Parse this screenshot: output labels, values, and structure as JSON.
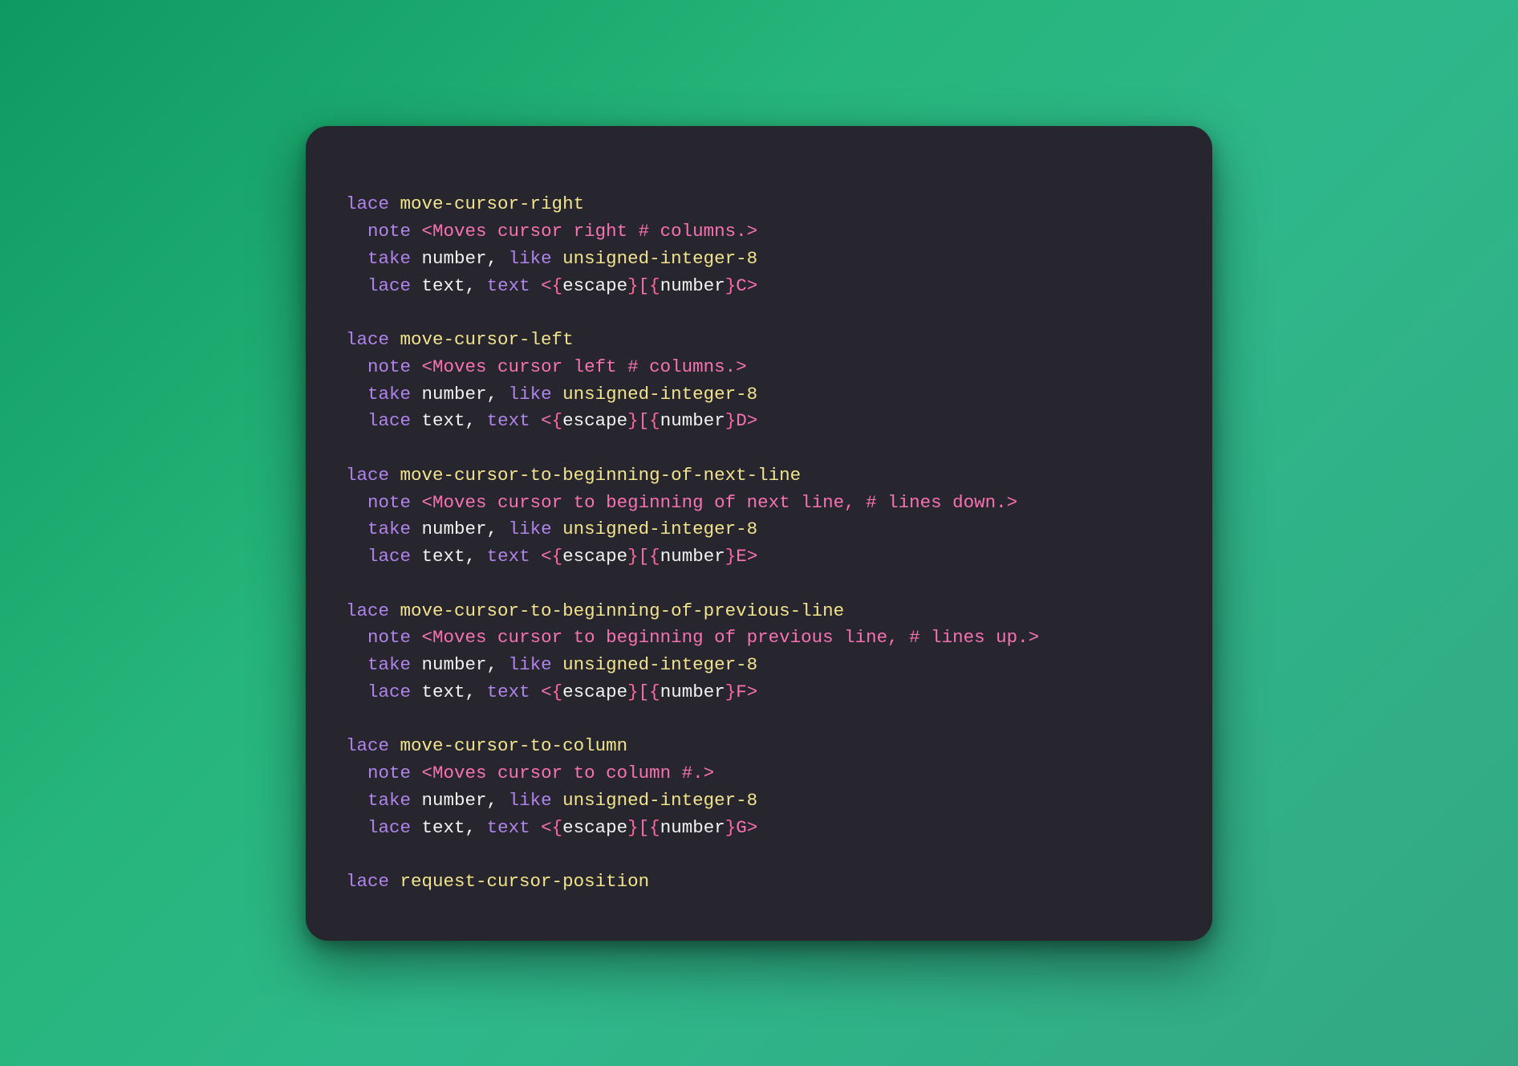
{
  "kw": {
    "lace": "lace",
    "note": "note",
    "take": "take",
    "like": "like",
    "text_kw": "text"
  },
  "tokens": {
    "number": "number",
    "text": "text",
    "uint8": "unsigned-integer-8",
    "escape": "escape",
    "lbr": "{",
    "rbr": "}",
    "lt": "<",
    "gt": ">",
    "lbracket": "[",
    "comma_sp": ", "
  },
  "blocks": [
    {
      "name": "move-cursor-right",
      "note": "Moves cursor right # columns.",
      "suffix": "C"
    },
    {
      "name": "move-cursor-left",
      "note": "Moves cursor left # columns.",
      "suffix": "D"
    },
    {
      "name": "move-cursor-to-beginning-of-next-line",
      "note": "Moves cursor to beginning of next line, # lines down.",
      "suffix": "E"
    },
    {
      "name": "move-cursor-to-beginning-of-previous-line",
      "note": "Moves cursor to beginning of previous line, # lines up.",
      "suffix": "F"
    },
    {
      "name": "move-cursor-to-column",
      "note": "Moves cursor to column #.",
      "suffix": "G"
    }
  ],
  "tail": {
    "name": "request-cursor-position"
  }
}
